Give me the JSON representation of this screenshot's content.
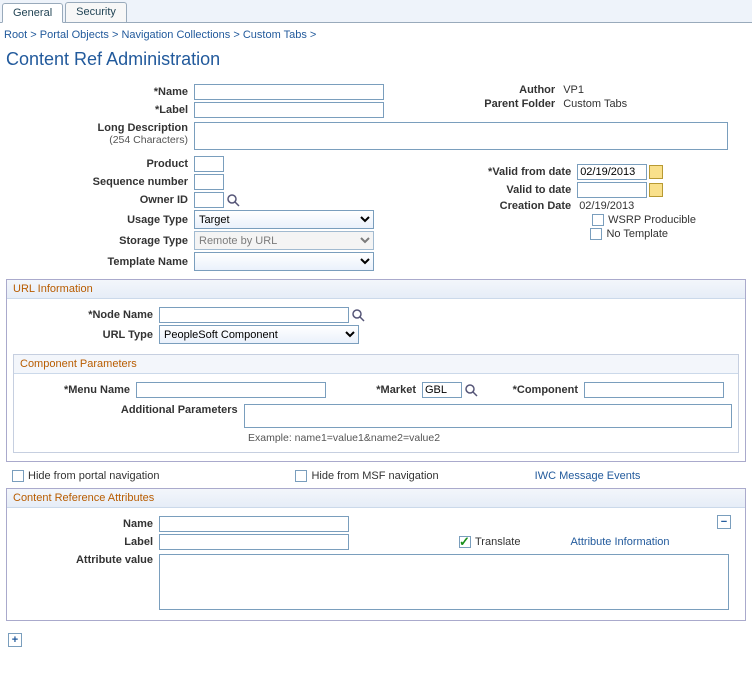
{
  "tabs": {
    "general": "General",
    "security": "Security"
  },
  "breadcrumb": [
    "Root",
    "Portal Objects",
    "Navigation Collections",
    "Custom Tabs"
  ],
  "page_title": "Content Ref Administration",
  "author_label": "Author",
  "author_value": "VP1",
  "parent_folder_label": "Parent Folder",
  "parent_folder_value": "Custom Tabs",
  "fields": {
    "name_label": "*Name",
    "name_value": "",
    "label_label": "*Label",
    "label_value": "",
    "long_desc_label": "Long Description",
    "long_desc_sub": "(254 Characters)",
    "long_desc_value": "",
    "product_label": "Product",
    "product_value": "",
    "seq_label": "Sequence number",
    "seq_value": "",
    "owner_label": "Owner ID",
    "owner_value": "",
    "usage_label": "Usage Type",
    "usage_value": "Target",
    "storage_label": "Storage Type",
    "storage_value": "Remote by URL",
    "template_label": "Template Name",
    "template_value": ""
  },
  "right": {
    "valid_from_label": "*Valid from date",
    "valid_from_value": "02/19/2013",
    "valid_to_label": "Valid to date",
    "valid_to_value": "",
    "creation_label": "Creation Date",
    "creation_value": "02/19/2013",
    "wsrp_label": "WSRP Producible",
    "no_template_label": "No Template"
  },
  "url_info": {
    "title": "URL Information",
    "node_label": "*Node Name",
    "node_value": "",
    "url_type_label": "URL Type",
    "url_type_value": "PeopleSoft Component"
  },
  "comp_params": {
    "title": "Component Parameters",
    "menu_label": "*Menu Name",
    "menu_value": "",
    "market_label": "*Market",
    "market_value": "GBL",
    "component_label": "*Component",
    "component_value": "",
    "addl_label": "Additional Parameters",
    "addl_value": "",
    "example": "Example: name1=value1&name2=value2"
  },
  "mid": {
    "hide_portal": "Hide from portal navigation",
    "hide_msf": "Hide from MSF navigation",
    "iwc_link": "IWC Message Events"
  },
  "attrs": {
    "title": "Content Reference Attributes",
    "name_label": "Name",
    "name_value": "",
    "label_label": "Label",
    "label_value": "",
    "translate_label": "Translate",
    "attr_info_link": "Attribute Information",
    "attr_value_label": "Attribute value",
    "attr_value_value": ""
  }
}
